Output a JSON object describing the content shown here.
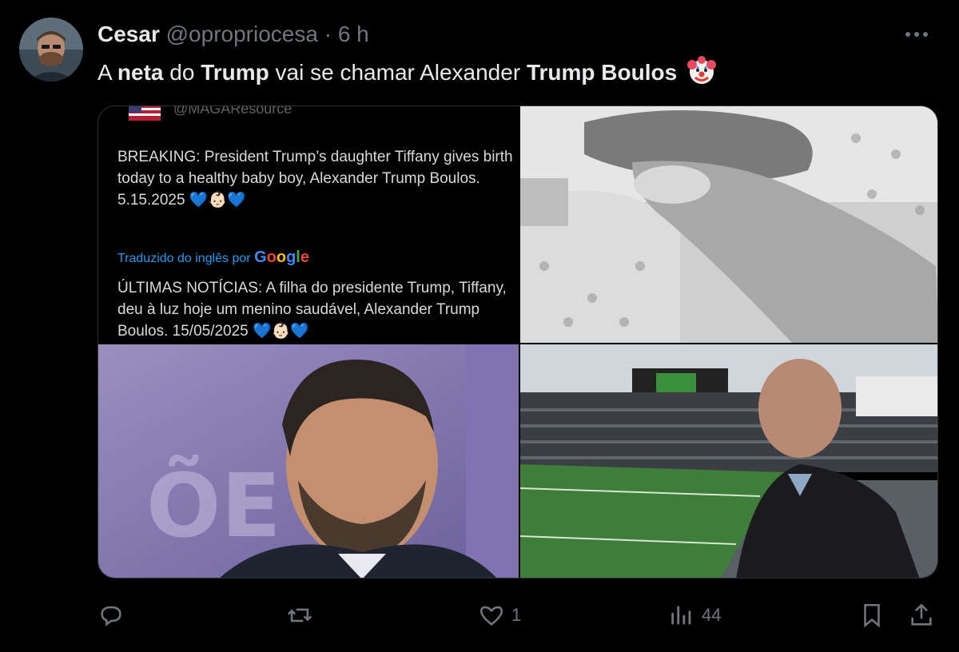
{
  "tweet": {
    "author_name": "Cesar",
    "author_handle": "@opropriocesa",
    "separator": "·",
    "time": "6 h",
    "text_parts": {
      "p1": "A ",
      "p2": "neta",
      "p3": " do ",
      "p4": "Trump",
      "p5": " vai se chamar Alexander ",
      "p6": "Trump Boulos"
    },
    "emoji": "clown-face"
  },
  "quote": {
    "handle": "@MAGAResource",
    "original_text": "BREAKING: President Trump’s daughter Tiffany gives birth today to a healthy baby boy, Alexander Trump Boulos. 5.15.2025 💙👶🏻💙",
    "translation_label": "Traduzido do inglês por",
    "translation_brand": "Google",
    "translated_text": "ÚLTIMAS NOTÍCIAS: A filha do presidente Trump, Tiffany, deu à luz hoje um menino saudável, Alexander Trump Boulos. 15/05/2025 💙👶🏻💙"
  },
  "actions": {
    "reply_count": "",
    "retweet_count": "",
    "like_count": "1",
    "views_count": "44"
  },
  "colors": {
    "background": "#000000",
    "text": "#e7e9ea",
    "secondary": "#71767b",
    "border": "#2f3336",
    "link": "#1d9bf0"
  }
}
